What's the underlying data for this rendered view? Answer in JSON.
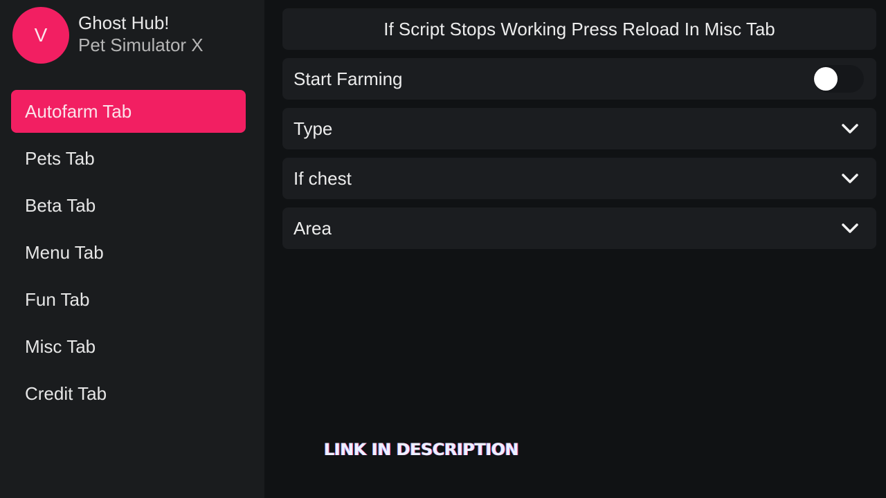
{
  "profile": {
    "avatar_letter": "V",
    "title": "Ghost Hub!",
    "subtitle": "Pet Simulator X"
  },
  "sidebar": {
    "items": [
      {
        "label": "Autofarm Tab",
        "active": true
      },
      {
        "label": "Pets Tab",
        "active": false
      },
      {
        "label": "Beta Tab",
        "active": false
      },
      {
        "label": "Menu Tab",
        "active": false
      },
      {
        "label": "Fun Tab",
        "active": false
      },
      {
        "label": "Misc Tab",
        "active": false
      },
      {
        "label": "Credit Tab",
        "active": false
      }
    ]
  },
  "main": {
    "notice": "If Script Stops Working Press Reload In Misc Tab",
    "toggle": {
      "label": "Start Farming",
      "on": false,
      "icon": "toggle-switch"
    },
    "dropdowns": [
      {
        "label": "Type",
        "icon": "chevron-down-icon"
      },
      {
        "label": "If chest",
        "icon": "chevron-down-icon"
      },
      {
        "label": "Area",
        "icon": "chevron-down-icon"
      }
    ]
  },
  "overlay": {
    "promo_text": "LINK IN DESCRIPTION"
  },
  "colors": {
    "accent": "#f21f62",
    "sidebar_bg": "#1a1c1e",
    "main_bg": "#101214",
    "row_bg": "#1b1d20"
  }
}
